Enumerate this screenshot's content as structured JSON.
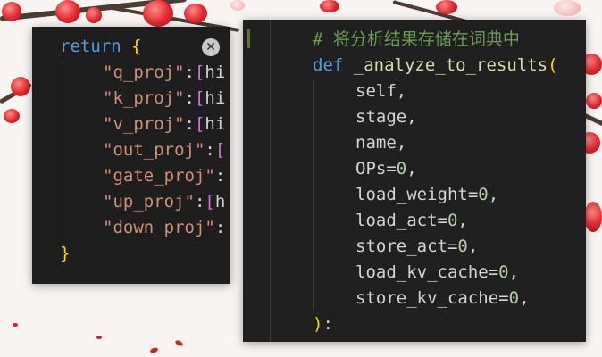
{
  "left_panel": {
    "close_icon": "close-icon",
    "lines": [
      {
        "kw": "return",
        "brace": "{"
      },
      {
        "key": "\"q_proj\"",
        "colon": ":",
        "bracket": "[",
        "rest": "hi"
      },
      {
        "key": "\"k_proj\"",
        "colon": ":",
        "bracket": "[",
        "rest": "hi"
      },
      {
        "key": "\"v_proj\"",
        "colon": ":",
        "bracket": "[",
        "rest": "hi"
      },
      {
        "key": "\"out_proj\"",
        "colon": ":",
        "bracket": "[",
        "rest": ""
      },
      {
        "key": "\"gate_proj\"",
        "colon": ":",
        "bracket": "",
        "rest": ""
      },
      {
        "key": "\"up_proj\"",
        "colon": ":",
        "bracket": "[",
        "rest": "h"
      },
      {
        "key": "\"down_proj\"",
        "colon": ":",
        "bracket": "",
        "rest": ""
      },
      {
        "brace": "}"
      }
    ]
  },
  "right_panel": {
    "comment": "# 将分析结果存储在词典中",
    "def_kw": "def",
    "func_name": "_analyze_to_results",
    "open_paren": "(",
    "params": [
      {
        "name": "self",
        "default": ""
      },
      {
        "name": "stage",
        "default": ""
      },
      {
        "name": "name",
        "default": ""
      },
      {
        "name": "OPs",
        "default": "0"
      },
      {
        "name": "load_weight",
        "default": "0"
      },
      {
        "name": "load_act",
        "default": "0"
      },
      {
        "name": "store_act",
        "default": "0"
      },
      {
        "name": "load_kv_cache",
        "default": "0"
      },
      {
        "name": "store_kv_cache",
        "default": "0"
      }
    ],
    "close_paren": ")",
    "colon": ":"
  }
}
